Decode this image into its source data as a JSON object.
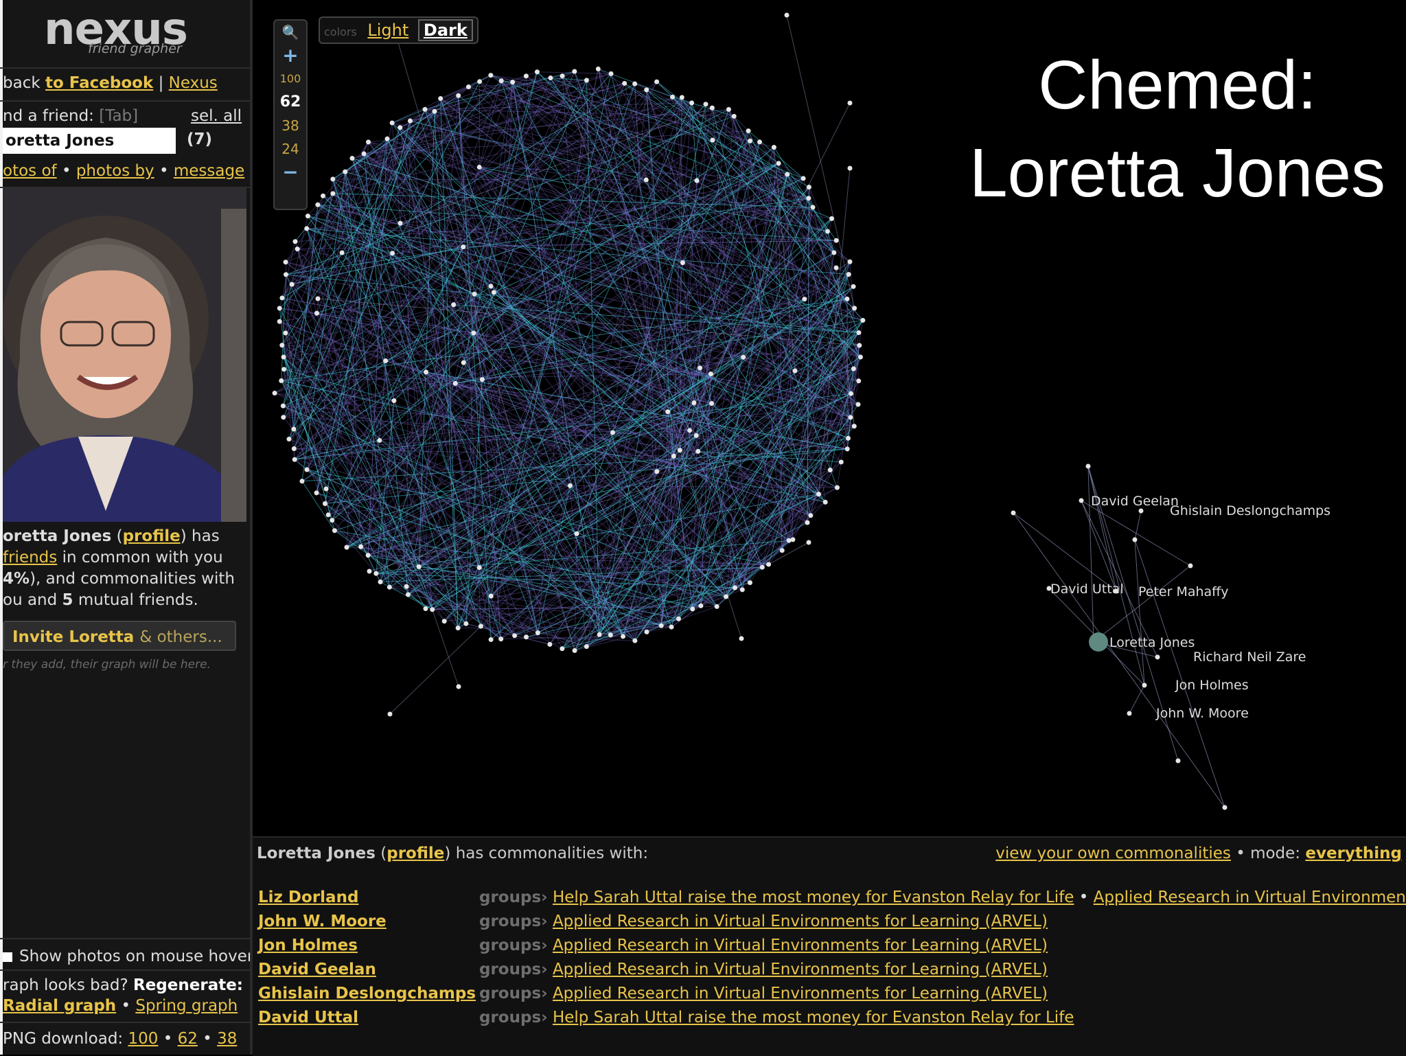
{
  "sidebar": {
    "logo": "nexus",
    "logo_sub": "friend grapher",
    "back_prefix": "back",
    "back_link": "to Facebook",
    "sep": "|",
    "nexus_link": "Nexus",
    "find_label": "nd a friend:",
    "find_hint": "[Tab]",
    "sel_all": "sel. all",
    "search_value": "oretta Jones",
    "search_count": "(7)",
    "photos_of": "otos of",
    "photos_by": "photos by",
    "message": "message",
    "bullet": "•",
    "desc_name": "oretta Jones",
    "desc_profile": "profile",
    "desc_has": "has",
    "desc_friends": "friends",
    "desc_common": "in common with you",
    "desc_pct": "4%",
    "desc_commonalities": "), and commonalities with",
    "desc_you": "ou and",
    "desc_mutual_num": "5",
    "desc_mutual": "mutual friends.",
    "invite_name": "Invite Loretta",
    "invite_rest": "& others...",
    "invite_note": "r they add, their graph will be here.",
    "show_photos": "Show photos on mouse hover",
    "graph_bad": "raph looks bad?",
    "regenerate": "Regenerate:",
    "radial": "Radial graph",
    "spring": "Spring graph",
    "png": "PNG download:",
    "png_sizes": [
      "100",
      "62",
      "38"
    ]
  },
  "graph": {
    "overlay_title_line1": "Chemed:",
    "overlay_title_line2": "Loretta Jones",
    "zoom_levels": [
      "100",
      "62",
      "38",
      "24"
    ],
    "zoom_plus": "+",
    "zoom_minus": "−",
    "colors_label": "colors",
    "light": "Light",
    "dark": "Dark",
    "node_labels": [
      "David Geelan",
      "Ghislain Deslongchamps",
      "David Uttal",
      "Peter Mahaffy",
      "Loretta Jones",
      "Richard Neil Zare",
      "Jon Holmes",
      "John W. Moore"
    ],
    "colors": {
      "edge_cyan": "#3fd0e0",
      "edge_purple": "#7f6fd6",
      "node": "#e6e6e6",
      "link": "#e8c44a"
    }
  },
  "bottom": {
    "head_name": "Loretta Jones",
    "head_profile": "profile",
    "head_rest": "has commonalities with:",
    "view_own": "view your own commonalities",
    "mode_label": "• mode:",
    "mode_value": "everything",
    "groups_label": "groups›",
    "rows": [
      {
        "name": "Liz Dorland",
        "group": "Help Sarah Uttal raise the most money for Evanston Relay for Life",
        "extra": "Applied Research in Virtual Environments for"
      },
      {
        "name": "John W. Moore",
        "group": "Applied Research in Virtual Environments for Learning (ARVEL)",
        "extra": ""
      },
      {
        "name": "Jon Holmes",
        "group": "Applied Research in Virtual Environments for Learning (ARVEL)",
        "extra": ""
      },
      {
        "name": "David Geelan",
        "group": "Applied Research in Virtual Environments for Learning (ARVEL)",
        "extra": ""
      },
      {
        "name": "Ghislain Deslongchamps",
        "group": "Applied Research in Virtual Environments for Learning (ARVEL)",
        "extra": ""
      },
      {
        "name": "David Uttal",
        "group": "Help Sarah Uttal raise the most money for Evanston Relay for Life",
        "extra": ""
      }
    ]
  }
}
